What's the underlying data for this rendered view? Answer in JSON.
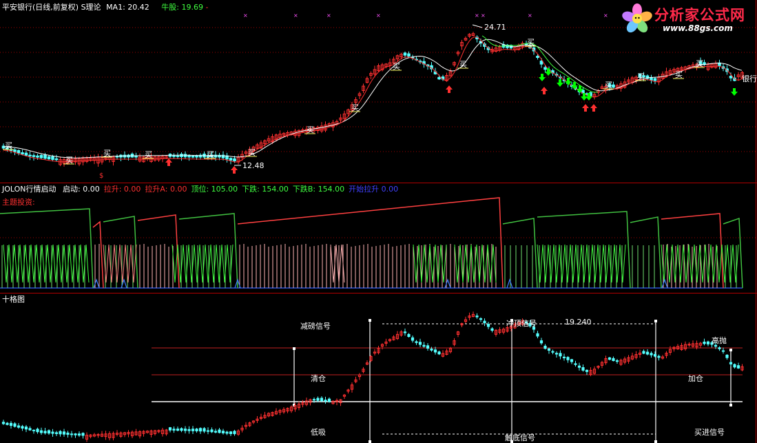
{
  "panel1": {
    "title": "平安银行(日线,前复权) S理论",
    "ma_label": "MA1: 20.42",
    "bull_label": "牛股: 19.69",
    "bull_suffix": " -",
    "high_price": "24.71",
    "low_price": "12.48",
    "stock_tag": "银行",
    "buy_char": "买",
    "dollar": "$",
    "cross": "××"
  },
  "panel2": {
    "title": "JOLON行情启动",
    "fields": [
      {
        "name": "启动:",
        "value": "0.00",
        "color": "#ffffff"
      },
      {
        "name": "拉升:",
        "value": "0.00",
        "color": "#ff3030"
      },
      {
        "name": "拉升A:",
        "value": "0.00",
        "color": "#ff3030"
      },
      {
        "name": "顶位:",
        "value": "105.00",
        "color": "#40ff40"
      },
      {
        "name": "下跌:",
        "value": "154.00",
        "color": "#40ff40"
      },
      {
        "name": "下跌B:",
        "value": "154.00",
        "color": "#40ff40"
      },
      {
        "name": "开始拉升",
        "value": "0.00",
        "color": "#4040ff"
      }
    ],
    "subtitle": "主题投资:"
  },
  "panel3": {
    "title": "十格图",
    "labels": {
      "jianbang": "减磅信号",
      "chongding": "冲顶信号",
      "price": "19.240",
      "gaopao": "高抛",
      "qingcang": "清仓",
      "jiacang": "加仓",
      "dixi": "低吸",
      "chudi": "触底信号",
      "maijin": "买进信号"
    }
  },
  "logo": {
    "title": "分析家公式网",
    "url": "www.88gs.com"
  },
  "colors": {
    "up": "#ff3030",
    "down": "#54ffff",
    "ma_white": "#ffffff",
    "ma_green": "#40ff40",
    "grid_red": "#a00000",
    "arrow_up": "#ff3030",
    "arrow_down": "#00ff00"
  }
}
